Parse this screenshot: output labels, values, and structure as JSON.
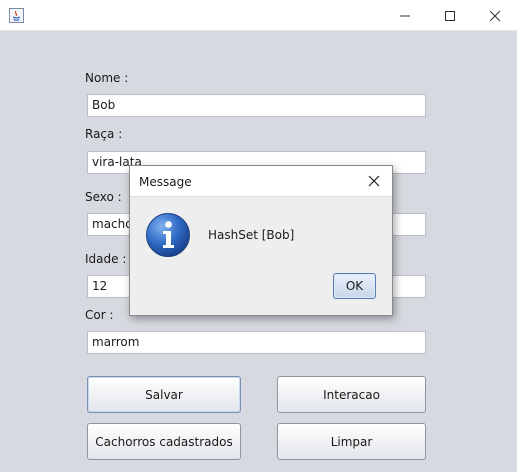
{
  "window": {
    "controls": {
      "minimize": "minimize",
      "maximize": "maximize",
      "close": "close"
    }
  },
  "form": {
    "nome_label": "Nome :",
    "nome_value": "Bob",
    "raca_label": "Raça :",
    "raca_value": "vira-lata",
    "sexo_label": "Sexo :",
    "sexo_value": "macho",
    "idade_label": "Idade :",
    "idade_value": "12",
    "cor_label": "Cor :",
    "cor_value": "marrom"
  },
  "buttons": {
    "salvar": "Salvar",
    "interacao": "Interacao",
    "cachorros": "Cachorros cadastrados",
    "limpar": "Limpar"
  },
  "dialog": {
    "title": "Message",
    "message": "HashSet [Bob]",
    "ok": "OK",
    "icon": "info-icon"
  },
  "colors": {
    "background": "#d6d9df",
    "info_icon_blue": "#2a5fb4",
    "ok_border": "#5b7cb3"
  }
}
